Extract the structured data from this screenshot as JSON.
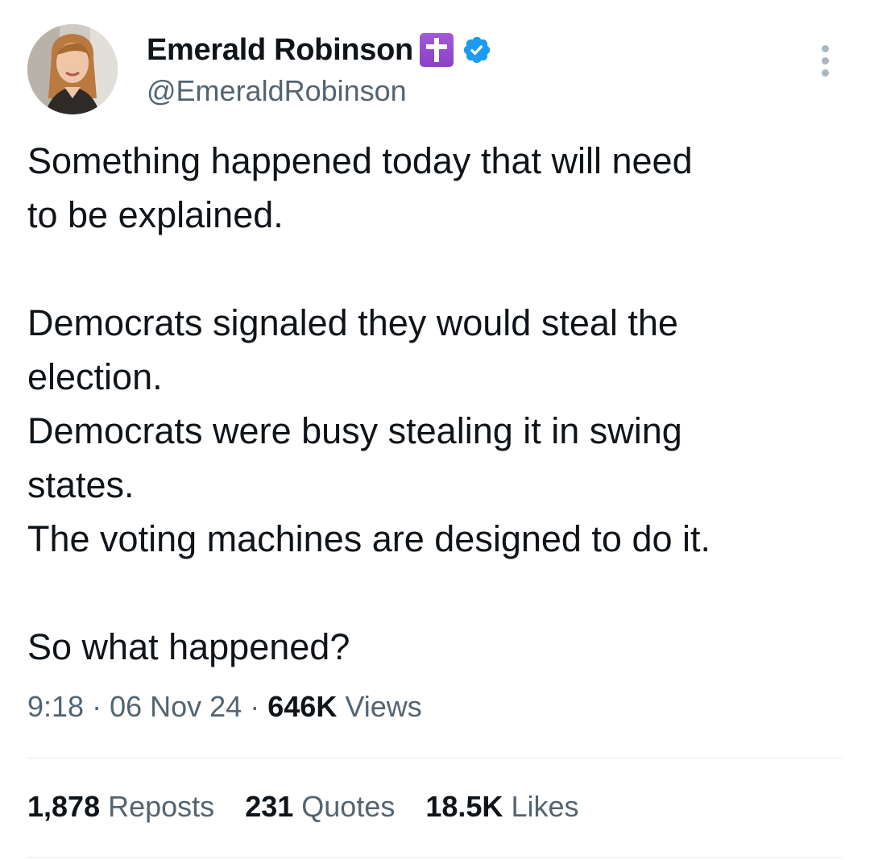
{
  "author": {
    "display_name": "Emerald Robinson",
    "name_emoji": "latin-cross-emoji",
    "verified_badge": "verified-badge-icon",
    "handle": "@EmeraldRobinson"
  },
  "tweet": {
    "lines": [
      "Something happened today that will need",
      "to be explained.",
      "",
      "Democrats signaled they would steal the",
      "election.",
      "Democrats were busy stealing it in swing",
      "states.",
      "The voting machines are designed to do it.",
      "",
      "So what happened?"
    ]
  },
  "meta": {
    "time": "9:18",
    "separator": "·",
    "date": "06 Nov 24",
    "views_count": "646K",
    "views_label": "Views"
  },
  "stats": {
    "reposts_count": "1,878",
    "reposts_label": "Reposts",
    "quotes_count": "231",
    "quotes_label": "Quotes",
    "likes_count": "18.5K",
    "likes_label": "Likes"
  },
  "colors": {
    "text_primary": "#0f1419",
    "text_secondary": "#536471",
    "verified_blue": "#1d9bf0",
    "emoji_purple": "#9b4fd6",
    "divider": "#e6e9eb"
  }
}
